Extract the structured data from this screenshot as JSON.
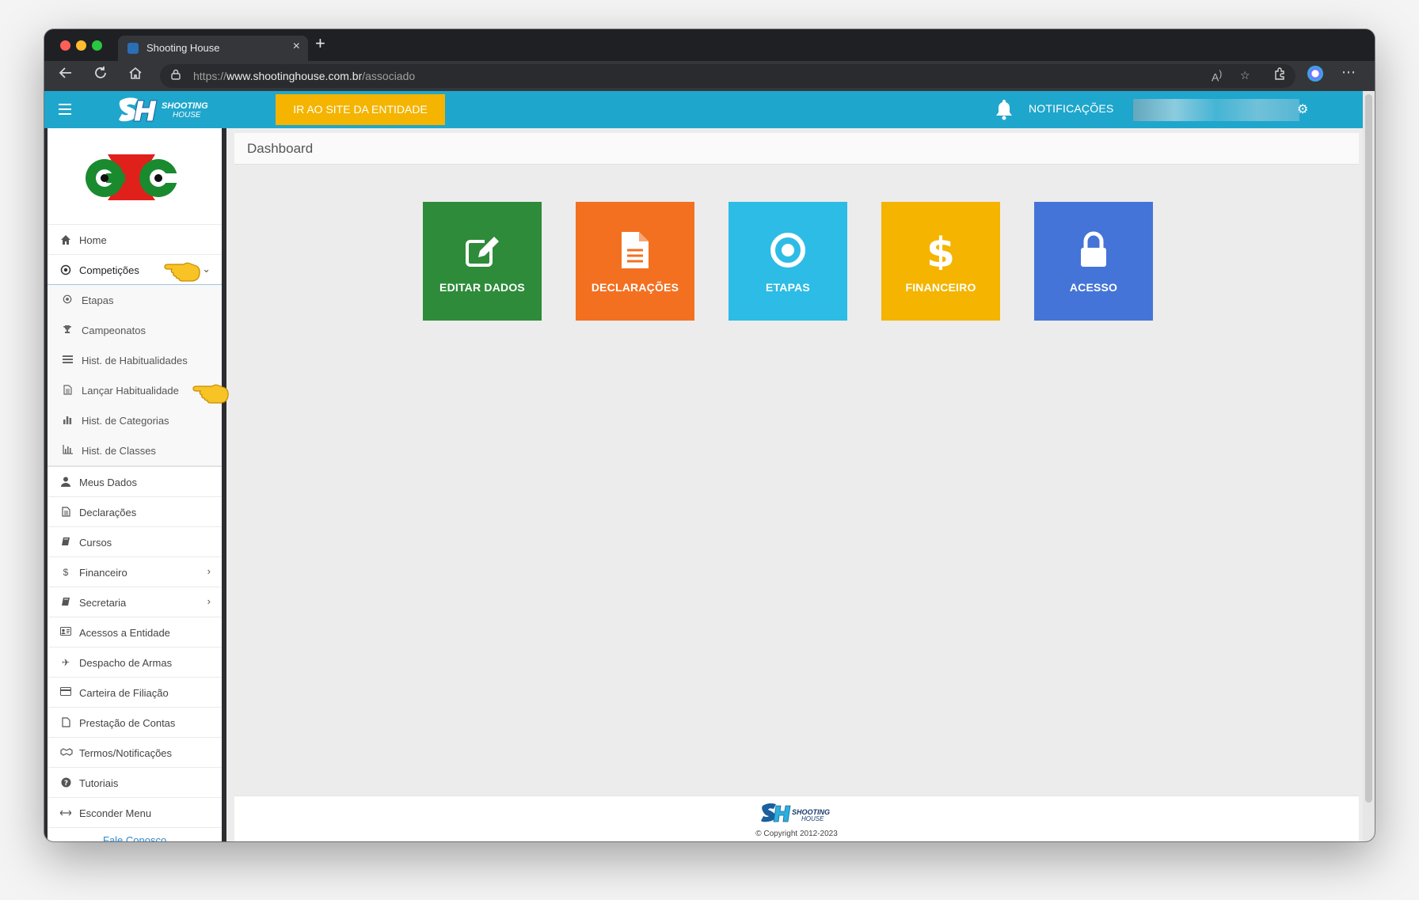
{
  "browser": {
    "tab_title": "Shooting House",
    "url_scheme": "https://",
    "url_host": "www.shootinghouse.com.br",
    "url_path": "/associado",
    "new_tab_symbol": "+",
    "close_symbol": "×"
  },
  "appbar": {
    "logo_text_1": "SHOOTING",
    "logo_text_2": "HOUSE",
    "cta_label": "IR AO SITE DA ENTIDADE",
    "notifications_label": "NOTIFICAÇÕES",
    "accent_color": "#1fa6cc",
    "cta_color": "#f4b400"
  },
  "sidebar": {
    "items_top": [
      {
        "label": "Home",
        "icon": "home-icon"
      },
      {
        "label": "Competições",
        "icon": "target-icon",
        "expanded": true
      }
    ],
    "sub_items": [
      {
        "label": "Etapas",
        "icon": "target-icon"
      },
      {
        "label": "Campeonatos",
        "icon": "trophy-icon"
      },
      {
        "label": "Hist. de Habitualidades",
        "icon": "list-icon"
      },
      {
        "label": "Lançar Habitualidade",
        "icon": "document-icon"
      },
      {
        "label": "Hist. de Categorias",
        "icon": "bar-chart-icon"
      },
      {
        "label": "Hist. de Classes",
        "icon": "bar-chart-outline-icon"
      }
    ],
    "items_bottom": [
      {
        "label": "Meus Dados",
        "icon": "user-icon"
      },
      {
        "label": "Declarações",
        "icon": "document-icon"
      },
      {
        "label": "Cursos",
        "icon": "book-icon"
      },
      {
        "label": "Financeiro",
        "icon": "dollar-icon",
        "chevron": true
      },
      {
        "label": "Secretaria",
        "icon": "book-icon",
        "chevron": true
      },
      {
        "label": "Acessos a Entidade",
        "icon": "id-card-icon"
      },
      {
        "label": "Despacho de Armas",
        "icon": "plane-icon"
      },
      {
        "label": "Carteira de Filiação",
        "icon": "credit-card-icon"
      },
      {
        "label": "Prestação de Contas",
        "icon": "file-icon"
      },
      {
        "label": "Termos/Notificações",
        "icon": "handshake-icon"
      },
      {
        "label": "Tutoriais",
        "icon": "question-icon"
      },
      {
        "label": "Esconder Menu",
        "icon": "arrows-icon"
      }
    ],
    "footer_link": "Fale Conosco"
  },
  "main": {
    "page_title": "Dashboard",
    "tiles": [
      {
        "label": "EDITAR DADOS",
        "color": "#2e8b3a",
        "icon": "edit-icon"
      },
      {
        "label": "DECLARAÇÕES",
        "color": "#f37021",
        "icon": "document-icon"
      },
      {
        "label": "ETAPAS",
        "color": "#2dbce5",
        "icon": "target-icon"
      },
      {
        "label": "FINANCEIRO",
        "color": "#f4b400",
        "icon": "dollar-icon"
      },
      {
        "label": "ACESSO",
        "color": "#4574d8",
        "icon": "lock-icon"
      }
    ],
    "footer_logo_1": "SHOOTING",
    "footer_logo_2": "HOUSE",
    "copyright": "© Copyright 2012-2023"
  }
}
